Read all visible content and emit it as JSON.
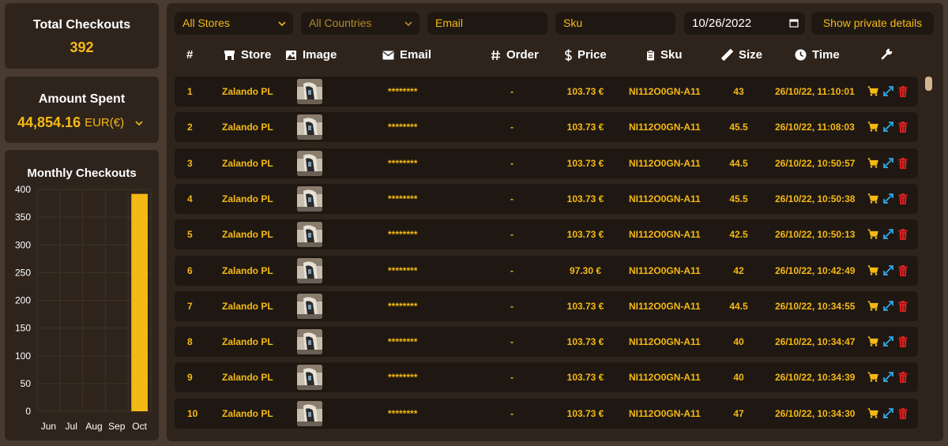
{
  "total_checkouts": {
    "title": "Total Checkouts",
    "value": "392"
  },
  "amount_spent": {
    "title": "Amount Spent",
    "value": "44,854.16",
    "currency": "EUR(€)"
  },
  "monthly": {
    "title": "Monthly Checkouts",
    "chart_data": {
      "type": "bar",
      "categories": [
        "Jun",
        "Jul",
        "Aug",
        "Sep",
        "Oct"
      ],
      "values": [
        0,
        0,
        0,
        0,
        392
      ],
      "ylim": [
        0,
        400
      ],
      "yticks": [
        0,
        50,
        100,
        150,
        200,
        250,
        300,
        350,
        400
      ],
      "color": "#f5b915",
      "grid": true
    }
  },
  "filters": {
    "stores": "All Stores",
    "countries": "All Countries",
    "email_placeholder": "Email",
    "sku_placeholder": "Sku",
    "date": "10/26/2022",
    "private_button": "Show private details"
  },
  "columns": {
    "num": "#",
    "store": "Store",
    "image": "Image",
    "email": "Email",
    "order": "Order",
    "price": "Price",
    "sku": "Sku",
    "size": "Size",
    "time": "Time"
  },
  "rows": [
    {
      "num": "1",
      "store": "Zalando PL",
      "email": "********",
      "order": "-",
      "price": "103.73 €",
      "sku": "NI112O0GN-A11",
      "size": "43",
      "time": "26/10/22, 11:10:01"
    },
    {
      "num": "2",
      "store": "Zalando PL",
      "email": "********",
      "order": "-",
      "price": "103.73 €",
      "sku": "NI112O0GN-A11",
      "size": "45.5",
      "time": "26/10/22, 11:08:03"
    },
    {
      "num": "3",
      "store": "Zalando PL",
      "email": "********",
      "order": "-",
      "price": "103.73 €",
      "sku": "NI112O0GN-A11",
      "size": "44.5",
      "time": "26/10/22, 10:50:57"
    },
    {
      "num": "4",
      "store": "Zalando PL",
      "email": "********",
      "order": "-",
      "price": "103.73 €",
      "sku": "NI112O0GN-A11",
      "size": "45.5",
      "time": "26/10/22, 10:50:38"
    },
    {
      "num": "5",
      "store": "Zalando PL",
      "email": "********",
      "order": "-",
      "price": "103.73 €",
      "sku": "NI112O0GN-A11",
      "size": "42.5",
      "time": "26/10/22, 10:50:13"
    },
    {
      "num": "6",
      "store": "Zalando PL",
      "email": "********",
      "order": "-",
      "price": "97.30 €",
      "sku": "NI112O0GN-A11",
      "size": "42",
      "time": "26/10/22, 10:42:49"
    },
    {
      "num": "7",
      "store": "Zalando PL",
      "email": "********",
      "order": "-",
      "price": "103.73 €",
      "sku": "NI112O0GN-A11",
      "size": "44.5",
      "time": "26/10/22, 10:34:55"
    },
    {
      "num": "8",
      "store": "Zalando PL",
      "email": "********",
      "order": "-",
      "price": "103.73 €",
      "sku": "NI112O0GN-A11",
      "size": "40",
      "time": "26/10/22, 10:34:47"
    },
    {
      "num": "9",
      "store": "Zalando PL",
      "email": "********",
      "order": "-",
      "price": "103.73 €",
      "sku": "NI112O0GN-A11",
      "size": "40",
      "time": "26/10/22, 10:34:39"
    },
    {
      "num": "10",
      "store": "Zalando PL",
      "email": "********",
      "order": "-",
      "price": "103.73 €",
      "sku": "NI112O0GN-A11",
      "size": "47",
      "time": "26/10/22, 10:34:30"
    }
  ],
  "colors": {
    "accent": "#f5b915",
    "panel": "#2e241c",
    "row": "#1f1812",
    "background": "#4a3b30",
    "link": "#2fa8e8",
    "danger": "#e32020"
  },
  "icons": {
    "cart": "cart-icon",
    "expand": "expand-icon",
    "delete": "trash-icon"
  }
}
